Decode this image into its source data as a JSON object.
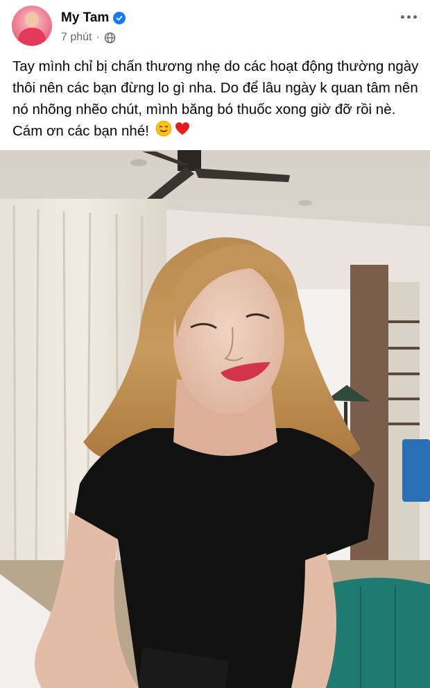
{
  "post": {
    "author": {
      "name": "My Tam",
      "verified": true
    },
    "time": "7 phút",
    "separator": "·",
    "privacy_icon": "globe-icon",
    "more_icon": "more-options-icon",
    "text": "Tay mình chỉ bị chấn thương nhẹ do các hoạt động thường ngày thôi nên các bạn đừng lo gì nha. Do để lâu ngày k quan tâm nên nó nhõng nhẽo chút, mình băng bó thuốc xong giờ đỡ rồi nè. Cám ơn các bạn nhé!",
    "emojis": [
      "smiling-face-emoji",
      "red-heart-emoji"
    ]
  },
  "colors": {
    "verified_badge": "#1877f2",
    "meta_text": "#65676b",
    "text": "#050505"
  }
}
